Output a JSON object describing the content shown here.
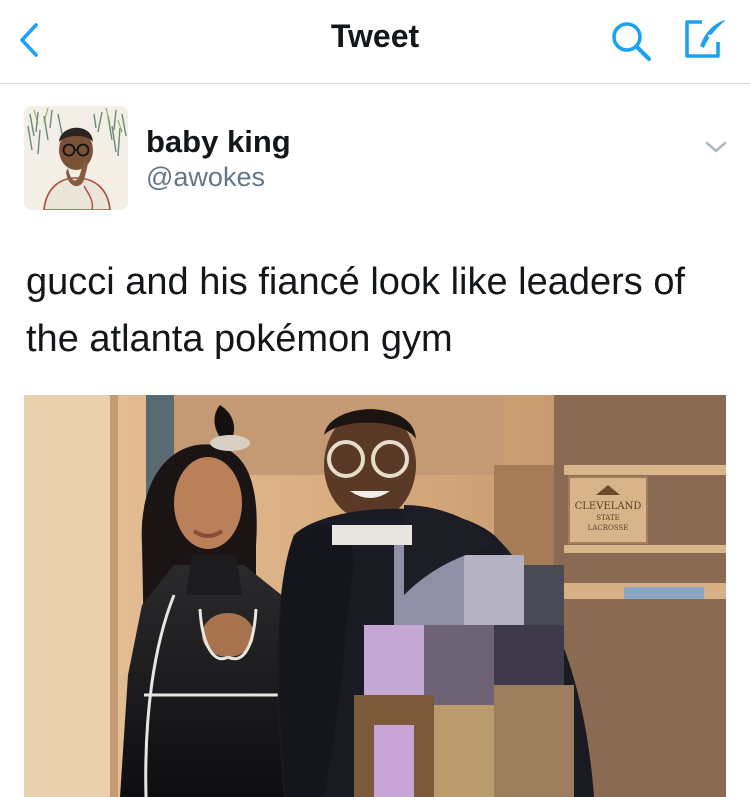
{
  "navbar": {
    "back_icon": "chevron-left-icon",
    "title": "Tweet",
    "search_icon": "search-icon",
    "compose_icon": "compose-tweet-icon",
    "accent_color": "#1da1f2"
  },
  "tweet": {
    "author": {
      "display_name": "baby king",
      "handle": "@awokes"
    },
    "menu_icon": "chevron-down-icon",
    "text": [
      "gucci and his fiancé look like leaders of",
      "the atlanta pokémon gym"
    ],
    "media": {
      "background_sign": {
        "line1": "CLEVELAND",
        "line2": "STATE",
        "line3": "LACROSSE"
      }
    }
  }
}
